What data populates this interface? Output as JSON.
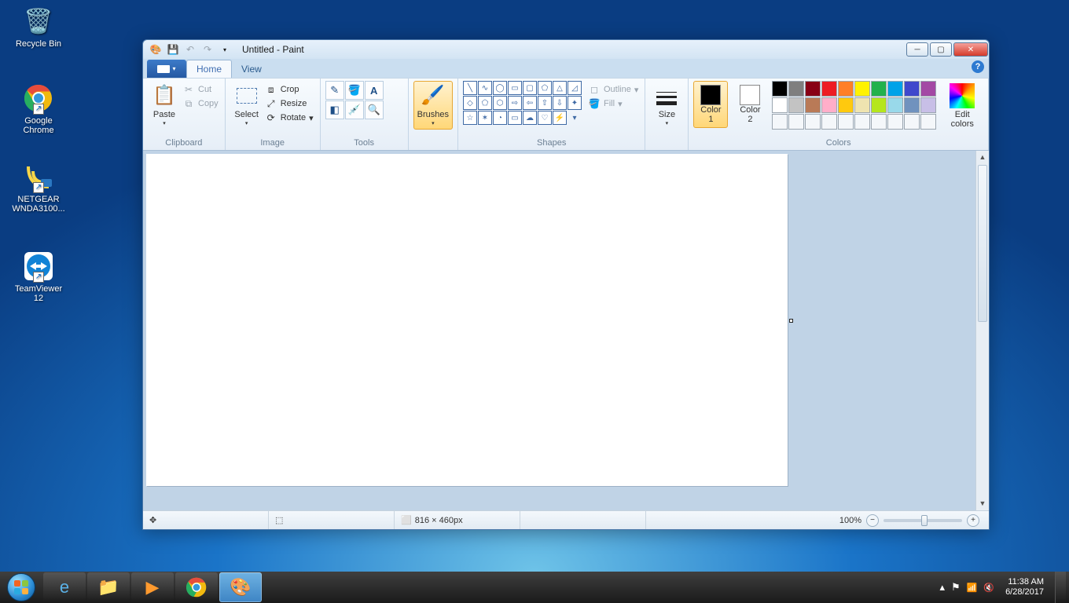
{
  "desktop_icons": {
    "recycle_bin": "Recycle Bin",
    "chrome": "Google Chrome",
    "netgear": "NETGEAR WNDA3100...",
    "teamviewer": "TeamViewer 12"
  },
  "window": {
    "title": "Untitled - Paint",
    "tabs": {
      "home": "Home",
      "view": "View"
    },
    "help_tooltip": "?"
  },
  "clipboard": {
    "paste": "Paste",
    "cut": "Cut",
    "copy": "Copy",
    "label": "Clipboard"
  },
  "image": {
    "select": "Select",
    "crop": "Crop",
    "resize": "Resize",
    "rotate": "Rotate",
    "label": "Image"
  },
  "tools": {
    "label": "Tools"
  },
  "brushes": {
    "label": "Brushes"
  },
  "shapes": {
    "outline": "Outline",
    "fill": "Fill",
    "label": "Shapes"
  },
  "size": {
    "label": "Size"
  },
  "colors": {
    "c1": "Color 1",
    "c2": "Color 2",
    "edit": "Edit colors",
    "label": "Colors",
    "row1": [
      "#000000",
      "#7f7f7f",
      "#880015",
      "#ed1c24",
      "#ff7f27",
      "#fff200",
      "#22b14c",
      "#00a2e8",
      "#3f48cc",
      "#a349a4"
    ],
    "row2": [
      "#ffffff",
      "#c3c3c3",
      "#b97a57",
      "#ffaec9",
      "#ffc90e",
      "#efe4b0",
      "#b5e61d",
      "#99d9ea",
      "#7092be",
      "#c8bfe7"
    ]
  },
  "status": {
    "dimensions": "816 × 460px",
    "zoom": "100%"
  },
  "taskbar": {
    "time": "11:38 AM",
    "date": "6/28/2017"
  }
}
